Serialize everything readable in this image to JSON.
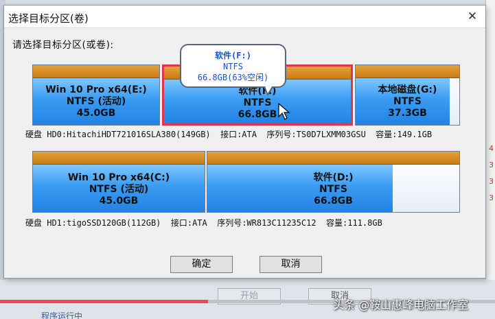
{
  "dialog": {
    "title": "选择目标分区(卷)",
    "close_glyph": "✕",
    "prompt": "请选择目标分区(或卷):"
  },
  "disks": [
    {
      "info": "硬盘 HD0:HitachiHDT721016SLA380(149GB)  接口:ATA  序列号:TS0D7LXMM03GSU  容量:149.1GB",
      "partitions": [
        {
          "name": "Win 10 Pro x64(E:)",
          "fs": "NTFS (活动)",
          "size": "45.0GB",
          "used_fraction": 1.0,
          "selected": false
        },
        {
          "name": "软件(F:)",
          "fs": "NTFS",
          "size": "66.8GB",
          "used_fraction": 0.37,
          "selected": true
        },
        {
          "name": "本地磁盘(G:)",
          "fs": "NTFS",
          "size": "37.3GB",
          "used_fraction": 0.85,
          "selected": false
        }
      ]
    },
    {
      "info": "硬盘 HD1:tigoSSD120GB(112GB)  接口:ATA  序列号:WR813C11235C12  容量:111.8GB",
      "partitions": [
        {
          "name": "Win 10 Pro x64(C:)",
          "fs": "NTFS (活动)",
          "size": "45.0GB",
          "used_fraction": 1.0,
          "selected": false
        },
        {
          "name": "软件(D:)",
          "fs": "NTFS",
          "size": "66.8GB",
          "used_fraction": 0.78,
          "selected": false
        }
      ]
    }
  ],
  "tooltip": {
    "line1": "软件(F:)",
    "line2": "NTFS",
    "line3": "66.8GB(63%空闲)"
  },
  "buttons": {
    "ok_label": "确定",
    "cancel_label": "取消"
  },
  "background": {
    "start_label": "开始",
    "cancel_label": "取消",
    "right_numbers": [
      "4",
      "3",
      "3",
      "3"
    ],
    "footer_text": "程序运行中"
  },
  "video": {
    "progress_fraction": 0.42
  },
  "watermark": "头条 @鞍山惠峰电脑工作室",
  "colors": {
    "partition_blue": "#2283e6",
    "partition_cap_orange": "#d48a1f",
    "selected_border": "#e2354b",
    "tooltip_text": "#1a50c8",
    "progress_red": "#f0455e"
  }
}
